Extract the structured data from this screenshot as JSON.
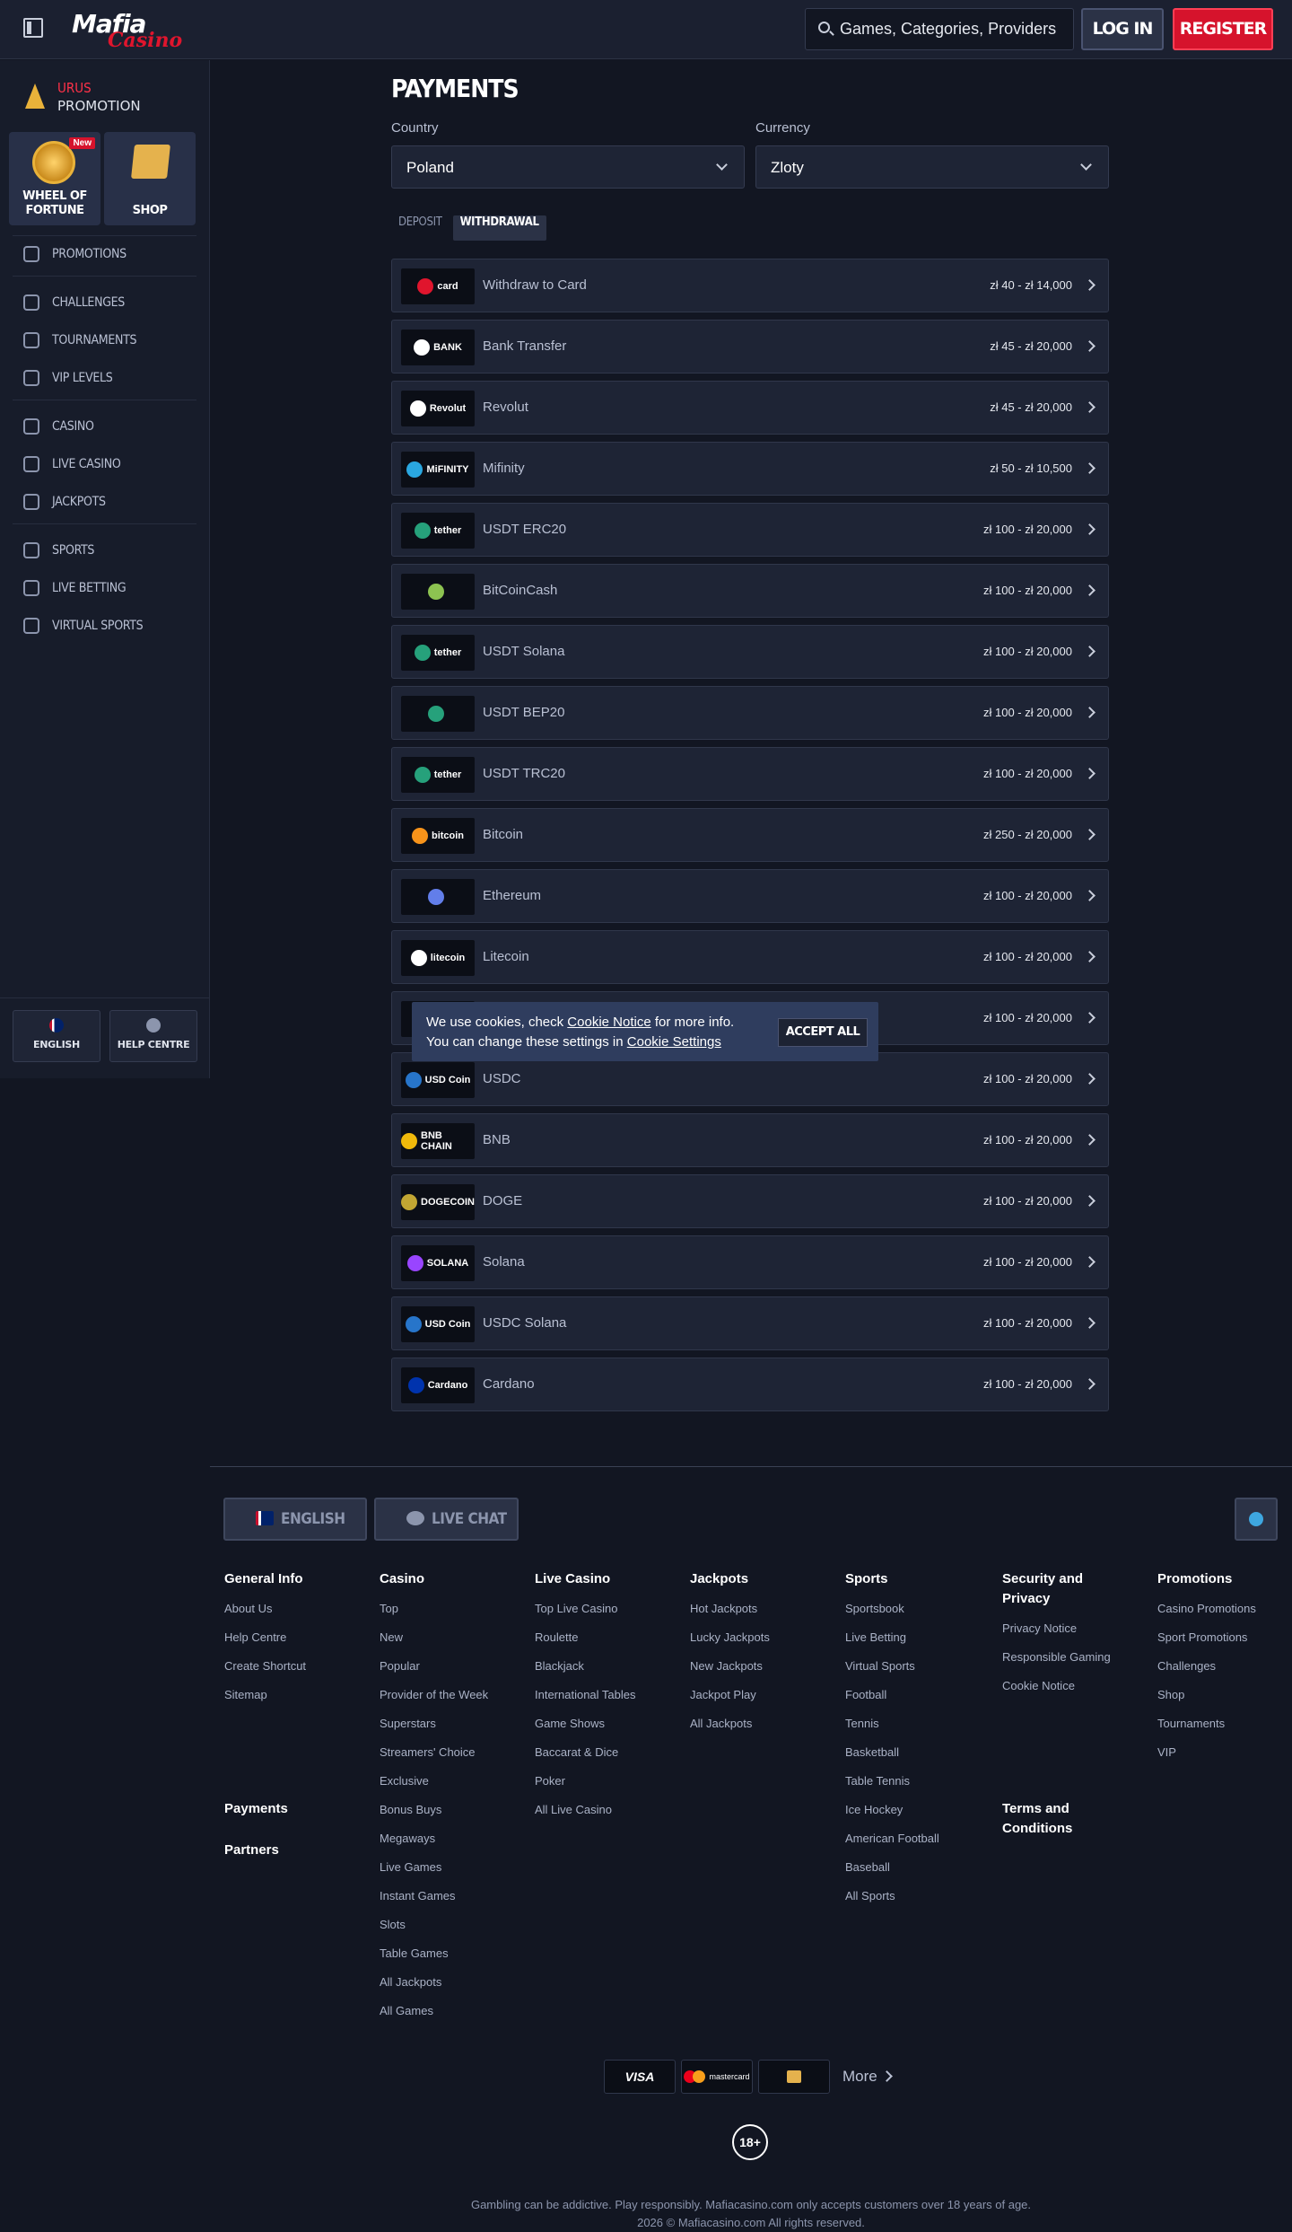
{
  "header": {
    "logo_text_1": "Mafia",
    "logo_text_2": "Casino",
    "search_placeholder": "Games, Categories, Providers",
    "login_label": "LOG IN",
    "register_label": "REGISTER"
  },
  "sidebar": {
    "promo_line1": "URUS",
    "promo_line2": "PROMOTION",
    "wheel_label": "WHEEL OF FORTUNE",
    "wheel_badge": "New",
    "shop_label": "SHOP",
    "items": [
      {
        "label": "PROMOTIONS",
        "icon": "gift-icon"
      },
      {
        "label": "CHALLENGES",
        "icon": "badge-icon"
      },
      {
        "label": "TOURNAMENTS",
        "icon": "podium-icon"
      },
      {
        "label": "VIP LEVELS",
        "icon": "diamond-icon"
      },
      {
        "label": "CASINO",
        "icon": "spade-icon"
      },
      {
        "label": "LIVE CASINO",
        "icon": "cards-icon"
      },
      {
        "label": "JACKPOTS",
        "icon": "clover-icon"
      },
      {
        "label": "SPORTS",
        "icon": "ball-icon"
      },
      {
        "label": "LIVE BETTING",
        "icon": "stopwatch-icon"
      },
      {
        "label": "VIRTUAL SPORTS",
        "icon": "monitor-icon"
      }
    ],
    "language_label": "ENGLISH",
    "help_label": "HELP CENTRE"
  },
  "payments": {
    "title": "PAYMENTS",
    "country_label": "Country",
    "country_value": "Poland",
    "currency_label": "Currency",
    "currency_value": "Zloty",
    "tabs": [
      "DEPOSIT",
      "WITHDRAWAL"
    ],
    "active_tab": "WITHDRAWAL",
    "methods": [
      {
        "name": "Withdraw to Card",
        "range": "zł 40 - zł 14,000",
        "logo": "card",
        "accent": "#e0152d"
      },
      {
        "name": "Bank Transfer",
        "range": "zł 45 - zł 20,000",
        "logo": "BANK",
        "accent": "#ffffff"
      },
      {
        "name": "Revolut",
        "range": "zł 45 - zł 20,000",
        "logo": "Revolut",
        "accent": "#ffffff"
      },
      {
        "name": "Mifinity",
        "range": "zł 50 - zł 10,500",
        "logo": "MiFINITY",
        "accent": "#2aa7e0"
      },
      {
        "name": "USDT ERC20",
        "range": "zł 100 - zł 20,000",
        "logo": "tether",
        "accent": "#26a17b"
      },
      {
        "name": "BitCoinCash",
        "range": "zł 100 - zł 20,000",
        "logo": "",
        "accent": "#8dc351"
      },
      {
        "name": "USDT Solana",
        "range": "zł 100 - zł 20,000",
        "logo": "tether",
        "accent": "#26a17b"
      },
      {
        "name": "USDT BEP20",
        "range": "zł 100 - zł 20,000",
        "logo": "",
        "accent": "#26a17b"
      },
      {
        "name": "USDT TRC20",
        "range": "zł 100 - zł 20,000",
        "logo": "tether",
        "accent": "#26a17b"
      },
      {
        "name": "Bitcoin",
        "range": "zł 250 - zł 20,000",
        "logo": "bitcoin",
        "accent": "#f7931a"
      },
      {
        "name": "Ethereum",
        "range": "zł 100 - zł 20,000",
        "logo": "",
        "accent": "#627eea"
      },
      {
        "name": "Litecoin",
        "range": "zł 100 - zł 20,000",
        "logo": "litecoin",
        "accent": "#ffffff"
      },
      {
        "name": "",
        "range": "zł 100 - zł 20,000",
        "logo": "",
        "accent": "#e0152d"
      },
      {
        "name": "USDC",
        "range": "zł 100 - zł 20,000",
        "logo": "USD Coin",
        "accent": "#2775ca"
      },
      {
        "name": "BNB",
        "range": "zł 100 - zł 20,000",
        "logo": "BNB CHAIN",
        "accent": "#f0b90b"
      },
      {
        "name": "DOGE",
        "range": "zł 100 - zł 20,000",
        "logo": "DOGECOIN",
        "accent": "#c2a633"
      },
      {
        "name": "Solana",
        "range": "zł 100 - zł 20,000",
        "logo": "SOLANA",
        "accent": "#9945ff"
      },
      {
        "name": "USDC Solana",
        "range": "zł 100 - zł 20,000",
        "logo": "USD Coin",
        "accent": "#2775ca"
      },
      {
        "name": "Cardano",
        "range": "zł 100 - zł 20,000",
        "logo": "Cardano",
        "accent": "#0033ad"
      }
    ]
  },
  "cookie": {
    "line1_pre": "We use cookies, check ",
    "line1_link": "Cookie Notice",
    "line1_post": " for more info.",
    "line2_pre": "You can change these settings in ",
    "line2_link": "Cookie Settings",
    "accept_label": "ACCEPT ALL"
  },
  "footer": {
    "language_label": "ENGLISH",
    "chat_label": "LIVE CHAT",
    "columns": [
      {
        "heading": "General Info",
        "items": [
          "About Us",
          "Help Centre",
          "Create Shortcut",
          "Sitemap"
        ]
      },
      {
        "heading": "Casino",
        "items": [
          "Top",
          "New",
          "Popular",
          "Provider of the Week",
          "Superstars",
          "Streamers' Choice",
          "Exclusive",
          "Bonus Buys",
          "Megaways",
          "Live Games",
          "Instant Games",
          "Slots",
          "Table Games",
          "All Jackpots",
          "All Games"
        ]
      },
      {
        "heading": "Live Casino",
        "items": [
          "Top Live Casino",
          "Roulette",
          "Blackjack",
          "International Tables",
          "Game Shows",
          "Baccarat & Dice",
          "Poker",
          "All Live Casino"
        ]
      },
      {
        "heading": "Jackpots",
        "items": [
          "Hot Jackpots",
          "Lucky Jackpots",
          "New Jackpots",
          "Jackpot Play",
          "All Jackpots"
        ]
      },
      {
        "heading": "Sports",
        "items": [
          "Sportsbook",
          "Live Betting",
          "Virtual Sports",
          "Football",
          "Tennis",
          "Basketball",
          "Table Tennis",
          "Ice Hockey",
          "American Football",
          "Baseball",
          "All Sports"
        ]
      },
      {
        "heading": "Security and Privacy",
        "items": [
          "Privacy Notice",
          "Responsible Gaming",
          "Cookie Notice"
        ]
      },
      {
        "heading": "Promotions",
        "items": [
          "Casino Promotions",
          "Sport Promotions",
          "Challenges",
          "Shop",
          "Tournaments",
          "VIP"
        ]
      }
    ],
    "payments_link": "Payments",
    "partners_link": "Partners",
    "terms_link": "Terms and Conditions",
    "visa_label": "VISA",
    "mastercard_label": "mastercard",
    "more_label": "More",
    "age_label": "18+",
    "legal_1": "Gambling can be addictive. Play responsibly. Mafiacasino.com only accepts customers over 18 years of age.",
    "legal_2": "2026 © Mafiacasino.com All rights reserved."
  }
}
